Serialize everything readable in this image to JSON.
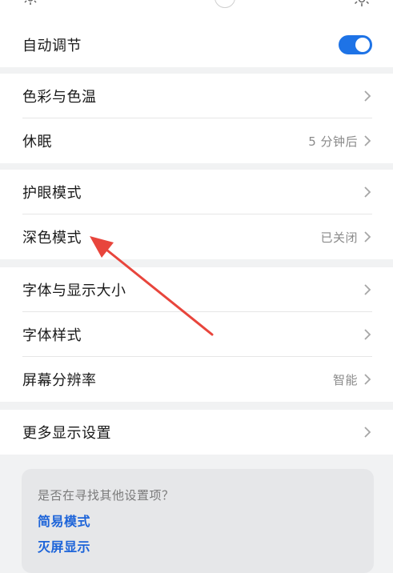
{
  "auto_adjust": {
    "label": "自动调节",
    "enabled": true
  },
  "group1": {
    "color_temp": {
      "label": "色彩与色温"
    },
    "sleep": {
      "label": "休眠",
      "value": "5 分钟后"
    }
  },
  "group2": {
    "eye_comfort": {
      "label": "护眼模式"
    },
    "dark_mode": {
      "label": "深色模式",
      "value": "已关闭"
    }
  },
  "group3": {
    "font_size": {
      "label": "字体与显示大小"
    },
    "font_style": {
      "label": "字体样式"
    },
    "resolution": {
      "label": "屏幕分辨率",
      "value": "智能"
    }
  },
  "group4": {
    "more": {
      "label": "更多显示设置"
    }
  },
  "suggestions": {
    "question": "是否在寻找其他设置项？",
    "links": [
      "简易模式",
      "灭屏显示"
    ]
  },
  "colors": {
    "accent": "#1e73e6",
    "annotation_arrow": "#e8453c",
    "link": "#1d64d9"
  }
}
